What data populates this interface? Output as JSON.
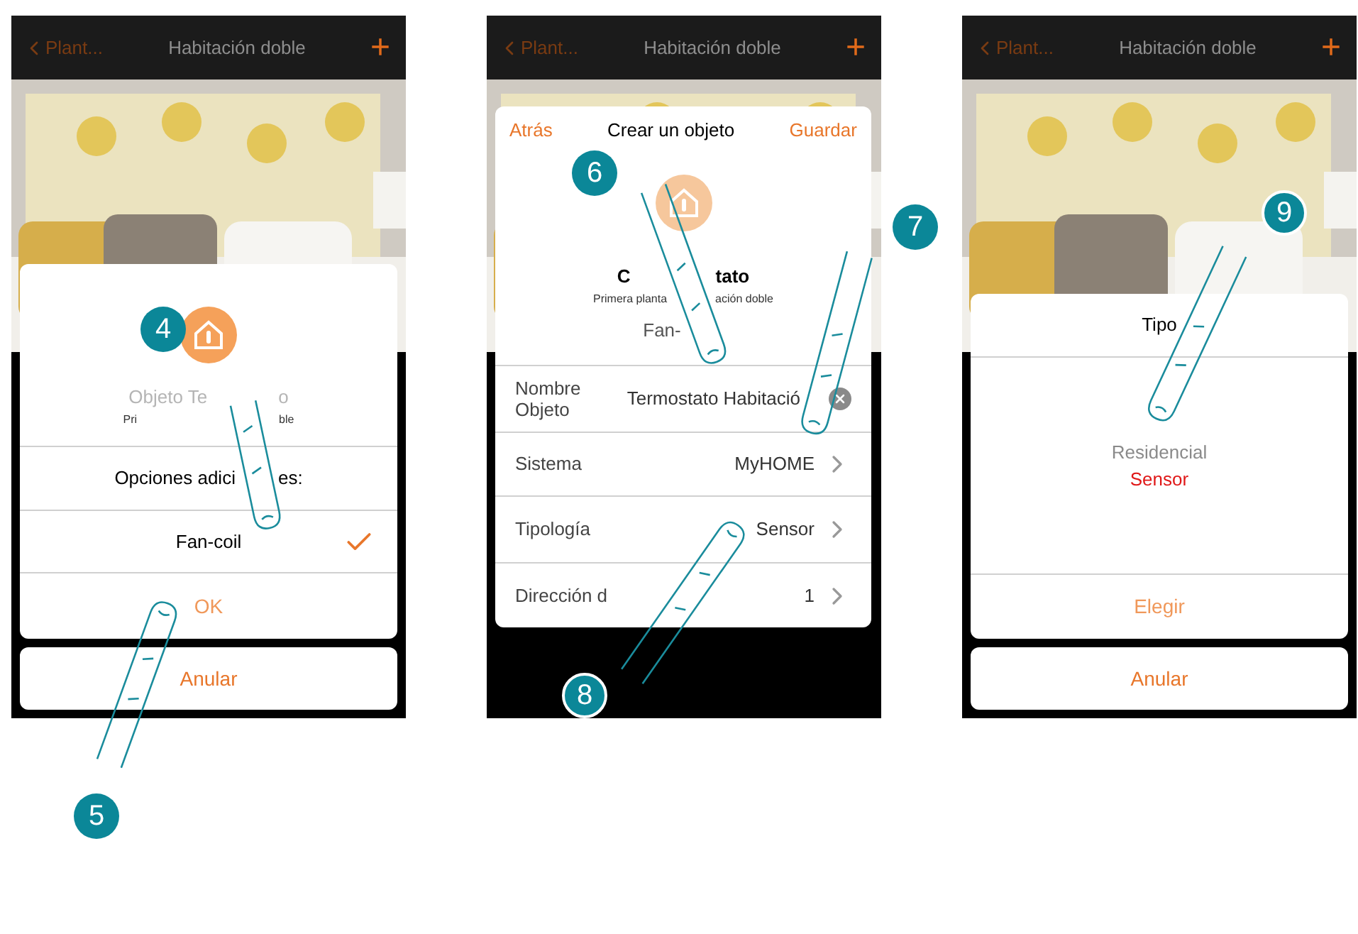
{
  "screens": [
    {
      "header": {
        "back": "Plant...",
        "title": "Habitación doble",
        "add": "+"
      },
      "dialog": {
        "kind": "options",
        "title_parts": [
          "Objeto Te",
          "o"
        ],
        "subtitle_parts": [
          "Pri",
          "ble"
        ],
        "heading_parts": [
          "Opciones adici",
          "es:"
        ],
        "options": [
          {
            "label": "Fan-coil",
            "checked": true
          }
        ],
        "confirm": "OK",
        "cancel": "Anular"
      }
    },
    {
      "header": {
        "back": "Plant...",
        "title": "Habitación doble",
        "add": "+"
      },
      "dialog": {
        "kind": "form",
        "back": "Atrás",
        "title": "Crear un objeto",
        "save": "Guardar",
        "name_parts": [
          "C",
          "tato"
        ],
        "subtitle_parts": [
          "Primera planta",
          "ación doble"
        ],
        "option": "Fan-",
        "fields": [
          {
            "label": "Nombre Objeto",
            "value": "Termostato Habitació",
            "kind": "text"
          },
          {
            "label": "Sistema",
            "value": "MyHOME",
            "kind": "link"
          },
          {
            "label": "Tipología",
            "value": "Sensor",
            "kind": "link"
          },
          {
            "label": "Dirección d",
            "value": "1",
            "kind": "link"
          }
        ]
      }
    },
    {
      "header": {
        "back": "Plant...",
        "title": "Habitación doble",
        "add": "+"
      },
      "dialog": {
        "kind": "picker",
        "title": "Tipo",
        "items": [
          {
            "label": "Residencial",
            "selected": false
          },
          {
            "label": "Sensor",
            "selected": true
          }
        ],
        "confirm": "Elegir",
        "cancel": "Anular"
      }
    }
  ],
  "steps": [
    {
      "label": "4"
    },
    {
      "label": "5"
    },
    {
      "label": "6"
    },
    {
      "label": "7"
    },
    {
      "label": "8"
    },
    {
      "label": "9"
    }
  ]
}
